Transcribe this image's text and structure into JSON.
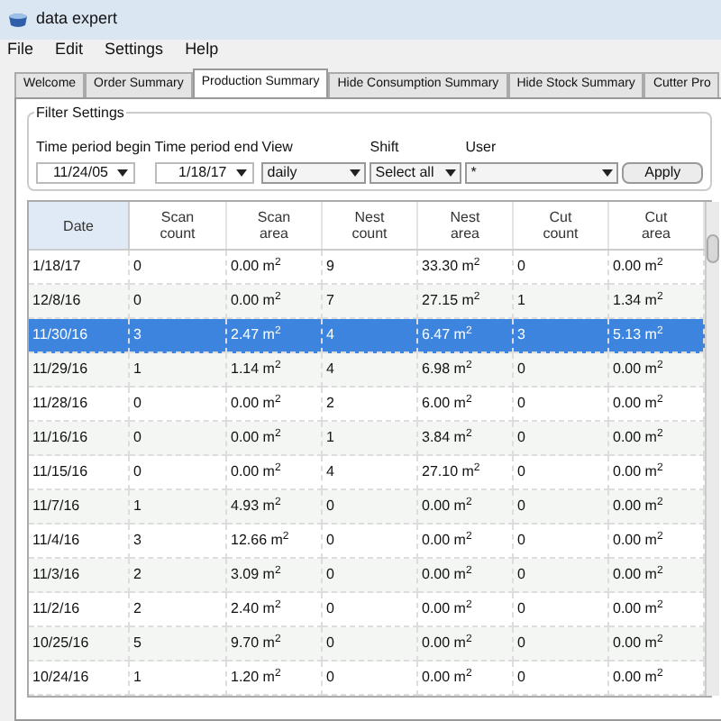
{
  "window": {
    "title": "data expert"
  },
  "menu": [
    "File",
    "Edit",
    "Settings",
    "Help"
  ],
  "tabs": [
    {
      "label": "Welcome",
      "selected": false
    },
    {
      "label": "Order Summary",
      "selected": false
    },
    {
      "label": "Production Summary",
      "selected": true
    },
    {
      "label": "Hide Consumption Summary",
      "selected": false
    },
    {
      "label": "Hide Stock Summary",
      "selected": false
    },
    {
      "label": "Cutter Pro",
      "selected": false
    }
  ],
  "filter": {
    "title": "Filter Settings",
    "fields": [
      {
        "label": "Time period begin",
        "value": "11/24/05",
        "kind": "date"
      },
      {
        "label": "Time period end",
        "value": "1/18/17",
        "kind": "date"
      },
      {
        "label": "View",
        "value": "daily",
        "kind": "select"
      },
      {
        "label": "Shift",
        "value": "Select all",
        "kind": "select"
      },
      {
        "label": "User",
        "value": "*",
        "kind": "select"
      }
    ],
    "button": "Apply"
  },
  "table": {
    "columns": [
      "Date",
      "Scan count",
      "Scan area",
      "Nest count",
      "Nest area",
      "Cut count",
      "Cut area"
    ],
    "rows": [
      {
        "cells": [
          "1/18/17",
          "0",
          "0.00 m$^{2}$",
          "9",
          "33.30 m$^{2}$",
          "0",
          "0.00 m$^{2}$"
        ],
        "selected": false
      },
      {
        "cells": [
          "12/8/16",
          "0",
          "0.00 m$^{2}$",
          "7",
          "27.15 m$^{2}$",
          "1",
          "1.34 m$^{2}$"
        ],
        "selected": false
      },
      {
        "cells": [
          "11/30/16",
          "3",
          "2.47 m$^{2}$",
          "4",
          "6.47 m$^{2}$",
          "3",
          "5.13 m$^{2}$"
        ],
        "selected": true
      },
      {
        "cells": [
          "11/29/16",
          "1",
          "1.14 m$^{2}$",
          "4",
          "6.98 m$^{2}$",
          "0",
          "0.00 m$^{2}$"
        ],
        "selected": false
      },
      {
        "cells": [
          "11/28/16",
          "0",
          "0.00 m$^{2}$",
          "2",
          "6.00 m$^{2}$",
          "0",
          "0.00 m$^{2}$"
        ],
        "selected": false
      },
      {
        "cells": [
          "11/16/16",
          "0",
          "0.00 m$^{2}$",
          "1",
          "3.84 m$^{2}$",
          "0",
          "0.00 m$^{2}$"
        ],
        "selected": false
      },
      {
        "cells": [
          "11/15/16",
          "0",
          "0.00 m$^{2}$",
          "4",
          "27.10 m$^{2}$",
          "0",
          "0.00 m$^{2}$"
        ],
        "selected": false
      },
      {
        "cells": [
          "11/7/16",
          "1",
          "4.93 m$^{2}$",
          "0",
          "0.00 m$^{2}$",
          "0",
          "0.00 m$^{2}$"
        ],
        "selected": false
      },
      {
        "cells": [
          "11/4/16",
          "3",
          "12.66 m$^{2}$",
          "0",
          "0.00 m$^{2}$",
          "0",
          "0.00 m$^{2}$"
        ],
        "selected": false
      },
      {
        "cells": [
          "11/3/16",
          "2",
          "3.09 m$^{2}$",
          "0",
          "0.00 m$^{2}$",
          "0",
          "0.00 m$^{2}$"
        ],
        "selected": false
      },
      {
        "cells": [
          "11/2/16",
          "2",
          "2.40 m$^{2}$",
          "0",
          "0.00 m$^{2}$",
          "0",
          "0.00 m$^{2}$"
        ],
        "selected": false
      },
      {
        "cells": [
          "10/25/16",
          "5",
          "9.70 m$^{2}$",
          "0",
          "0.00 m$^{2}$",
          "0",
          "0.00 m$^{2}$"
        ],
        "selected": false
      },
      {
        "cells": [
          "10/24/16",
          "1",
          "1.20 m$^{2}$",
          "0",
          "0.00 m$^{2}$",
          "0",
          "0.00 m$^{2}$"
        ],
        "selected": false
      }
    ]
  }
}
